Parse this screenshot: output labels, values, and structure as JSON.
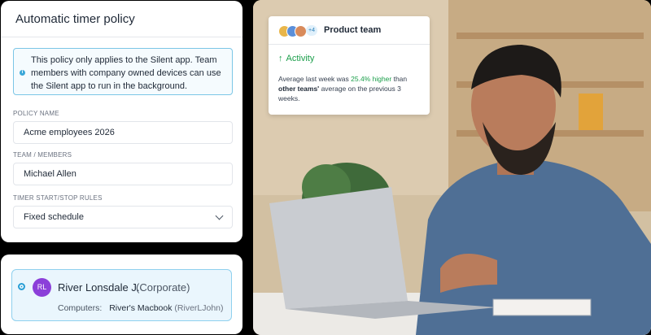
{
  "policy": {
    "title": "Automatic timer policy",
    "info_text": "This policy only applies to the Silent app. Team members with company owned devices can use the Silent app to run in the background.",
    "fields": {
      "policy_name": {
        "label": "POLICY NAME",
        "value": "Acme employees 2026"
      },
      "team_members": {
        "label": "TEAM / MEMBERS",
        "value": "Michael Allen"
      },
      "timer_rules": {
        "label": "TIMER START/STOP RULES",
        "value": "Fixed schedule"
      }
    }
  },
  "member": {
    "initials": "RL",
    "name": "River Lonsdale J.",
    "role": "(Corporate)",
    "computers_label": "Computers:",
    "computer_name": "River's Macbook",
    "computer_handle": "(RiverLJohn)"
  },
  "activity_card": {
    "extra_members": "+4",
    "team_name": "Product team",
    "title": "Activity",
    "text_prefix": "Average last week was ",
    "highlight": "25.4% higher",
    "text_mid": " than ",
    "bold_part": "other teams'",
    "text_suffix": " average on the previous 3 weeks."
  },
  "colors": {
    "accent_blue": "#2a9fd6",
    "avatar_purple": "#8b3fd9",
    "positive_green": "#1a9e4a"
  },
  "icons": {
    "info": "info-icon",
    "dropdown": "chevron-down-icon",
    "activity": "arrow-up-icon"
  }
}
